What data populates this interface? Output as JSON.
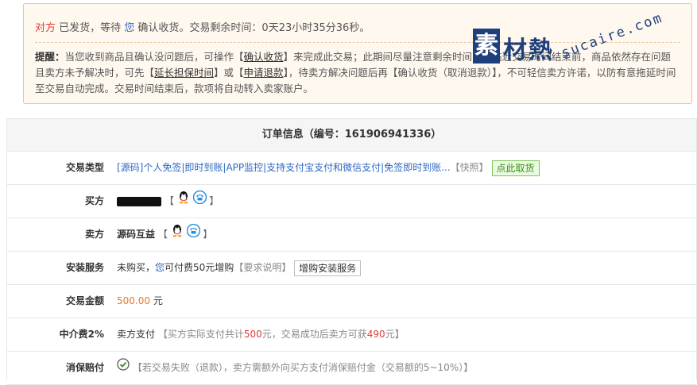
{
  "notice": {
    "status": {
      "party_seller": "对方",
      "text_shipped": " 已发货，等待 ",
      "party_you": "您",
      "text_confirm": " 确认收货。交易剩余时间：0天23小时35分36秒。"
    },
    "tips": {
      "label": "提醒：",
      "t1": "当您收到商品且确认没问题后，可操作【",
      "confirm_link": "确认收货",
      "t2": "】来完成此交易；此期间尽量注意剩余时间，当临近交易时间结束前，商品依然存在问题且卖方未予解决时，可先【",
      "extend_link": "延长担保时间",
      "t3": "】或【",
      "refund_link": "申请退款",
      "t4": "】，待卖方解决问题后再【确认收货（取消退款）】，不可轻信卖方许诺，以防有意拖延时间至交易自动完成。交易时间结束后，款项将自动转入卖家账户。"
    }
  },
  "watermark": {
    "box": "素",
    "text": "材熱",
    "url": "sucaire.com"
  },
  "order": {
    "title": "订单信息（编号：161906941336）",
    "rows": {
      "trade_type": {
        "label": "交易类型",
        "link": "[源码]个人免签|即时到账|APP监控|支持支付宝支付和微信支付|免签即时到账...",
        "snapshot": "【快照】",
        "cancel_button": "点此取货"
      },
      "buyer": {
        "label": "买方",
        "bracket_open": "【",
        "bracket_close": "】"
      },
      "seller": {
        "label": "卖方",
        "name": "源码互益",
        "bracket_open": "【",
        "bracket_close": "】"
      },
      "install": {
        "label": "安装服务",
        "t1": "未购买，",
        "you": "您",
        "t2": "可付费50元增购",
        "req": "【要求说明】",
        "button": "增购安装服务"
      },
      "amount": {
        "label": "交易金额",
        "value": "500.00",
        "unit": " 元"
      },
      "fee": {
        "label": "中介费2%",
        "payer": "卖方支付",
        "t1": "【买方实际支付共计",
        "v1": "500",
        "t2": "元，交易成功后卖方可获",
        "v2": "490",
        "t3": "元】"
      },
      "insurance": {
        "label": "消保赔付",
        "text": "【若交易失败（退款），卖方需额外向买方支付消保赔付金（交易额的5~10%）】"
      }
    }
  },
  "colors": {
    "accent_red": "#e4393c",
    "link_blue": "#2c68c2",
    "notice_bg": "#fff8ef",
    "notice_border": "#f6c08f"
  }
}
